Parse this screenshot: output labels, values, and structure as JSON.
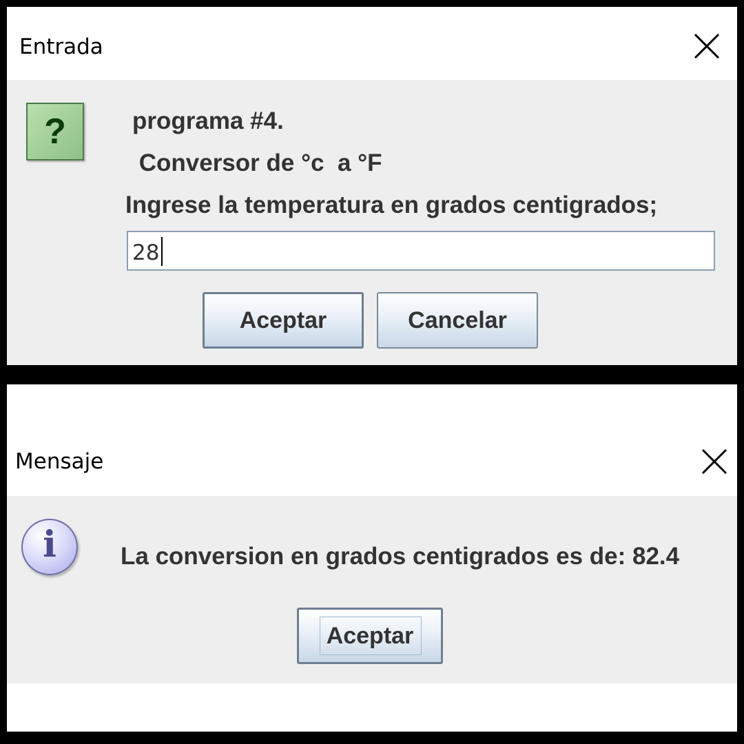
{
  "input_dialog": {
    "title": "Entrada",
    "icon": "question-icon",
    "icon_glyph": "?",
    "messages": [
      "programa #4.",
      " Conversor de °c  a °F",
      "Ingrese la temperatura en grados centigrados;"
    ],
    "input_value": "28",
    "accept_label": "Aceptar",
    "cancel_label": "Cancelar"
  },
  "message_dialog": {
    "title": "Mensaje",
    "icon": "info-icon",
    "icon_glyph": "i",
    "message": "La conversion en grados centigrados es de: 82.4",
    "accept_label": "Aceptar"
  }
}
